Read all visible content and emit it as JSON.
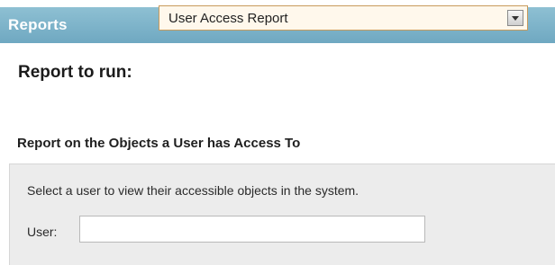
{
  "header": {
    "title": "Reports"
  },
  "report_selector": {
    "label": "Report to run:",
    "selected_value": "User Access Report",
    "arrow_icon": "chevron-down-icon"
  },
  "section": {
    "title": "Report on the Objects a User has Access To",
    "description": "Select a user to view their accessible objects in the system.",
    "user_label": "User:",
    "user_value": ""
  },
  "colors": {
    "header_bg": "#7fb4ca",
    "select_border": "#c89a5b",
    "select_bg": "#fff8ec",
    "panel_bg": "#ececec"
  }
}
